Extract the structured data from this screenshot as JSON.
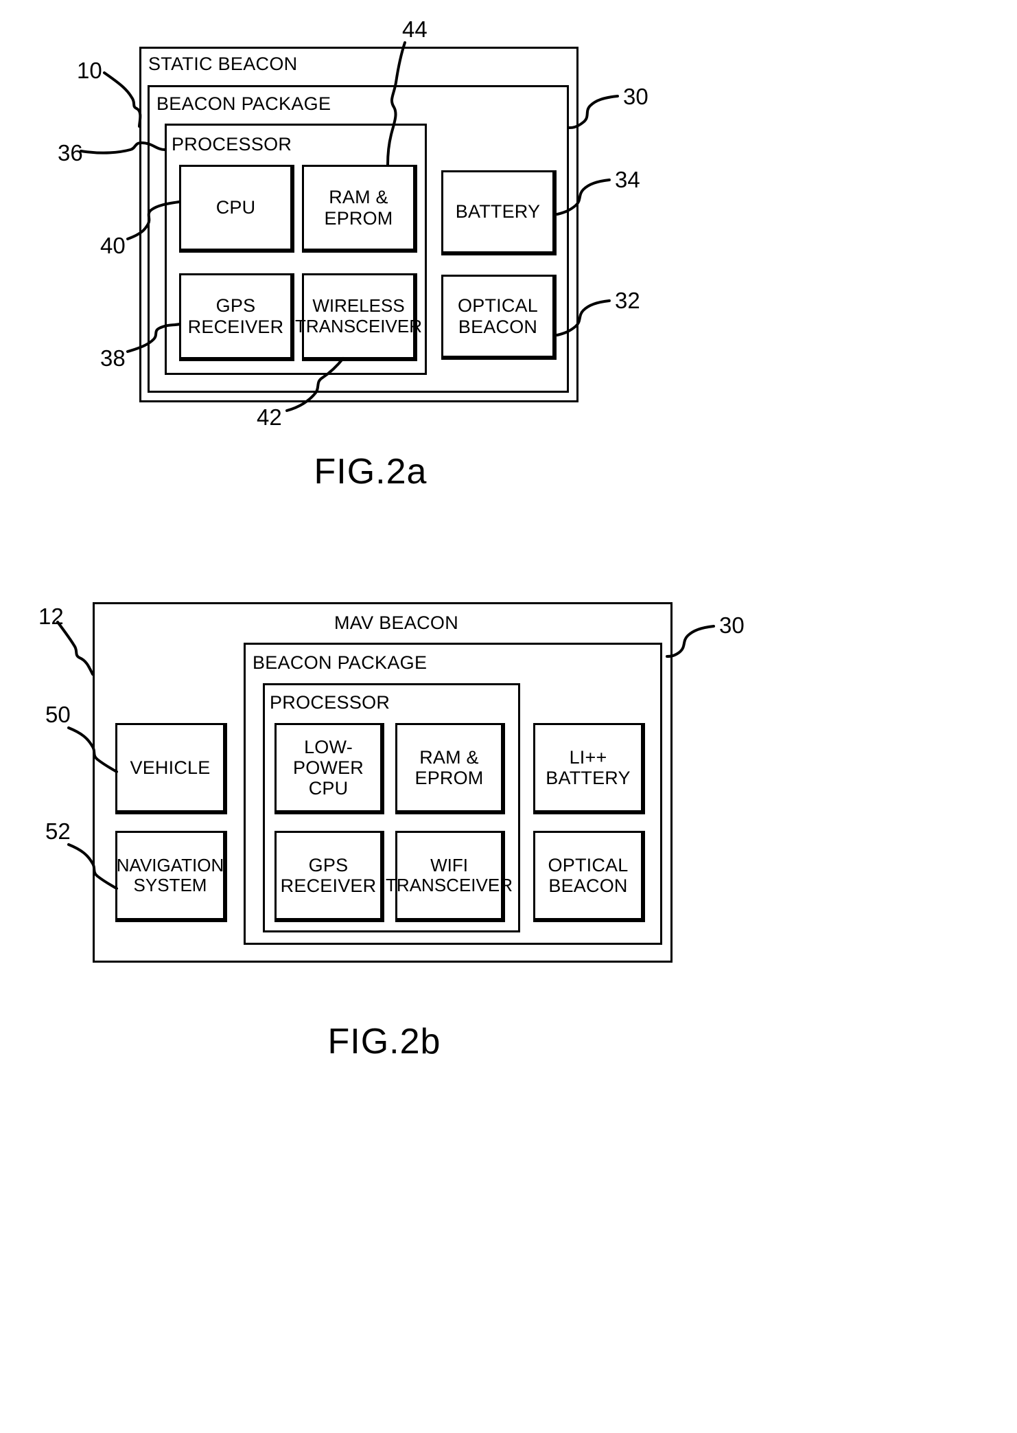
{
  "figures": [
    {
      "id": "fig2a",
      "label": "FIG.2a",
      "outer_title": "STATIC BEACON",
      "mid_title": "BEACON PACKAGE",
      "processor_title": "PROCESSOR",
      "processor_blocks": [
        {
          "name": "cpu",
          "lines": [
            "CPU"
          ]
        },
        {
          "name": "ram-eprom",
          "lines": [
            "RAM &",
            "EPROM"
          ]
        },
        {
          "name": "gps-receiver",
          "lines": [
            "GPS",
            "RECEIVER"
          ]
        },
        {
          "name": "wireless-transceiver",
          "lines": [
            "WIRELESS",
            "TRANSCEIVER"
          ]
        }
      ],
      "package_blocks": [
        {
          "name": "battery",
          "lines": [
            "BATTERY"
          ]
        },
        {
          "name": "optical-beacon",
          "lines": [
            "OPTICAL",
            "BEACON"
          ]
        }
      ],
      "refs": [
        {
          "name": "ref-10",
          "value": "10"
        },
        {
          "name": "ref-36",
          "value": "36"
        },
        {
          "name": "ref-40",
          "value": "40"
        },
        {
          "name": "ref-38",
          "value": "38"
        },
        {
          "name": "ref-42",
          "value": "42"
        },
        {
          "name": "ref-44",
          "value": "44"
        },
        {
          "name": "ref-30",
          "value": "30"
        },
        {
          "name": "ref-34",
          "value": "34"
        },
        {
          "name": "ref-32",
          "value": "32"
        }
      ]
    },
    {
      "id": "fig2b",
      "label": "FIG.2b",
      "outer_title": "MAV BEACON",
      "mid_title": "BEACON PACKAGE",
      "processor_title": "PROCESSOR",
      "vehicle_blocks": [
        {
          "name": "vehicle",
          "lines": [
            "VEHICLE"
          ]
        },
        {
          "name": "navigation-system",
          "lines": [
            "NAVIGATION",
            "SYSTEM"
          ]
        }
      ],
      "processor_blocks": [
        {
          "name": "low-power-cpu",
          "lines": [
            "LOW-",
            "POWER",
            "CPU"
          ]
        },
        {
          "name": "ram-eprom",
          "lines": [
            "RAM &",
            "EPROM"
          ]
        },
        {
          "name": "gps-receiver",
          "lines": [
            "GPS",
            "RECEIVER"
          ]
        },
        {
          "name": "wifi-transceiver",
          "lines": [
            "WIFI",
            "TRANSCEIVER"
          ]
        }
      ],
      "package_blocks": [
        {
          "name": "li-battery",
          "lines": [
            "LI++",
            "BATTERY"
          ]
        },
        {
          "name": "optical-beacon",
          "lines": [
            "OPTICAL",
            "BEACON"
          ]
        }
      ],
      "refs": [
        {
          "name": "ref-12",
          "value": "12"
        },
        {
          "name": "ref-50",
          "value": "50"
        },
        {
          "name": "ref-52",
          "value": "52"
        },
        {
          "name": "ref-30",
          "value": "30"
        }
      ]
    }
  ],
  "colors": {
    "ink": "#000000",
    "paper": "#ffffff"
  }
}
